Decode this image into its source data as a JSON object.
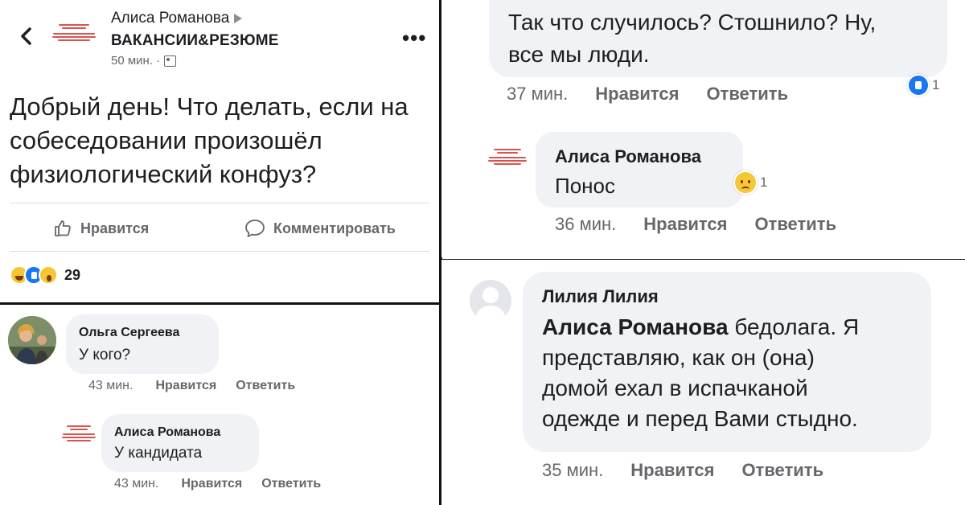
{
  "post": {
    "author": "Алиса Романова",
    "group": "ВАКАНСИИ&РЕЗЮМЕ",
    "time": "50 мин. ·",
    "body": "Добрый день! Что делать, если на собеседовании произошёл физиологический конфуз?",
    "like_label": "Нравится",
    "comment_label": "Комментировать",
    "reaction_count": "29",
    "icons": [
      "back-icon",
      "more-icon",
      "group-icon",
      "like-icon",
      "comment-icon",
      "haha-reaction-icon",
      "like-reaction-icon",
      "wow-reaction-icon"
    ]
  },
  "comments_left": [
    {
      "author": "Ольга Сергеева",
      "text": "У кого?",
      "time": "43 мин.",
      "like_label": "Нравится",
      "reply_label": "Ответить"
    },
    {
      "author": "Алиса Романова",
      "text": "У кандидата",
      "time": "43 мин.",
      "like_label": "Нравится",
      "reply_label": "Ответить"
    }
  ],
  "comments_right_top": [
    {
      "text_line1": "Так что случилось? Стошнило? Ну,",
      "text_line2": "все мы люди.",
      "time": "37 мин.",
      "like_label": "Нравится",
      "reply_label": "Ответить",
      "reaction_count": "1"
    },
    {
      "author": "Алиса Романова",
      "text": "Понос",
      "time": "36 мин.",
      "like_label": "Нравится",
      "reply_label": "Ответить",
      "reaction_count": "1"
    }
  ],
  "comment_bottom": {
    "author": "Лилия Лилия",
    "mention": "Алиса Романова",
    "line1_rest": " бедолага. Я",
    "line2": "представляю, как он (она)",
    "line3": "домой ехал в испачканой",
    "line4": "одежде и перед Вами стыдно.",
    "time": "35 мин.",
    "like_label": "Нравится",
    "reply_label": "Ответить"
  },
  "colors": {
    "bubble": "#f0f2f5",
    "meta_text": "#65676b",
    "like_blue": "#1877f2",
    "logo_red": "#d9534f"
  }
}
